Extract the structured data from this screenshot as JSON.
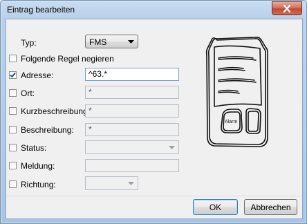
{
  "window": {
    "title": "Eintrag bearbeiten"
  },
  "form": {
    "typ": {
      "label": "Typ:",
      "value": "FMS"
    },
    "negate": {
      "label": "Folgende Regel negieren",
      "checked": false
    },
    "rows": [
      {
        "key": "adresse",
        "label": "Adresse:",
        "checked": true,
        "value": "^63.*",
        "kind": "text",
        "enabled": true
      },
      {
        "key": "ort",
        "label": "Ort:",
        "checked": false,
        "value": "*",
        "kind": "text",
        "enabled": false
      },
      {
        "key": "kurzbeschreibung",
        "label": "Kurzbeschreibung:",
        "checked": false,
        "value": "*",
        "kind": "text",
        "enabled": false
      },
      {
        "key": "beschreibung",
        "label": "Beschreibung:",
        "checked": false,
        "value": "*",
        "kind": "text",
        "enabled": false
      },
      {
        "key": "status",
        "label": "Status:",
        "checked": false,
        "value": "",
        "kind": "select",
        "enabled": false
      },
      {
        "key": "meldung",
        "label": "Meldung:",
        "checked": false,
        "value": "",
        "kind": "text",
        "enabled": false
      },
      {
        "key": "richtung",
        "label": "Richtung:",
        "checked": false,
        "value": "",
        "kind": "select",
        "enabled": false
      }
    ]
  },
  "illustration": {
    "label": "Alarm"
  },
  "buttons": {
    "ok": "OK",
    "cancel": "Abbrechen"
  }
}
